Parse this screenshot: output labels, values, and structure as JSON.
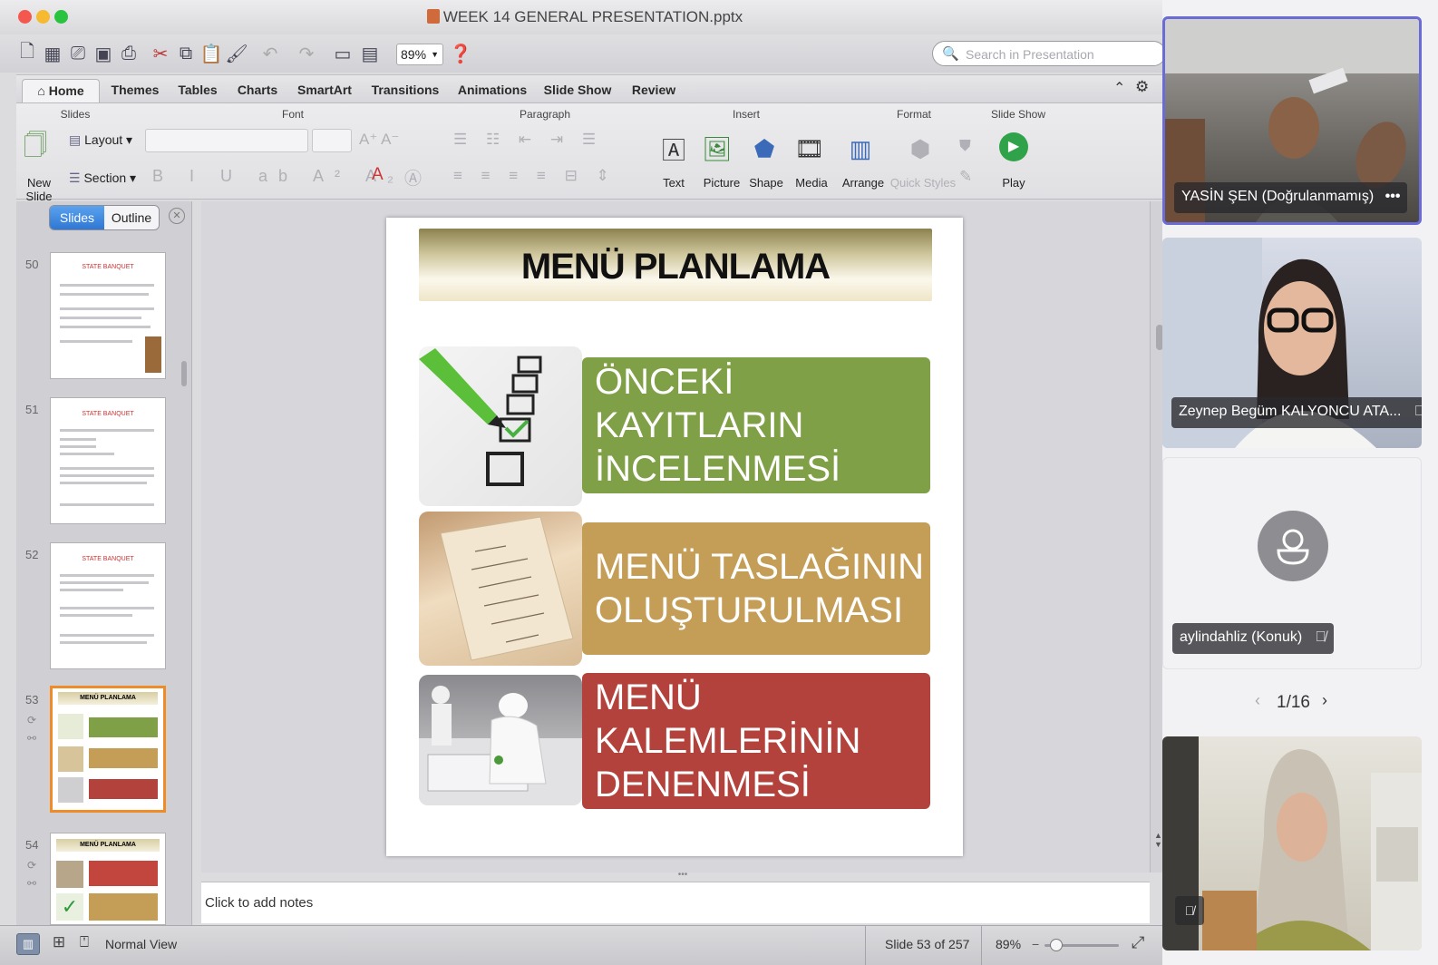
{
  "window": {
    "title": "WEEK 14 GENERAL PRESENTATION.pptx",
    "traffic_lights": [
      "#f4574d",
      "#f6b92f",
      "#29c33f"
    ]
  },
  "toolbar": {
    "zoom_value": "89%",
    "search_placeholder": "Search in Presentation"
  },
  "ribbon_tabs": [
    "Home",
    "Themes",
    "Tables",
    "Charts",
    "SmartArt",
    "Transitions",
    "Animations",
    "Slide Show",
    "Review"
  ],
  "ribbon": {
    "groups": {
      "slides": "Slides",
      "font": "Font",
      "paragraph": "Paragraph",
      "insert": "Insert",
      "format": "Format",
      "slideshow": "Slide Show"
    },
    "new_slide": "New Slide",
    "layout": "Layout",
    "section": "Section",
    "insert_items": [
      "Text",
      "Picture",
      "Shape",
      "Media"
    ],
    "arrange": "Arrange",
    "quick_styles": "Quick Styles",
    "play": "Play"
  },
  "left_pane": {
    "tabs": [
      "Slides",
      "Outline"
    ],
    "thumbnails": [
      {
        "number": "50",
        "title": "STATE BANQUET"
      },
      {
        "number": "51",
        "title": "STATE BANQUET"
      },
      {
        "number": "52",
        "title": "STATE BANQUET"
      },
      {
        "number": "53",
        "title": "MENÜ PLANLAMA"
      },
      {
        "number": "54",
        "title": "MENÜ PLANLAMA"
      }
    ]
  },
  "slide": {
    "title": "MENÜ PLANLAMA",
    "items": [
      {
        "line1": "ÖNCEKİ KAYITLARIN",
        "line2": "İNCELENMESİ",
        "color": "#7fa046"
      },
      {
        "line1": "MENÜ TASLAĞININ",
        "line2": "OLUŞTURULMASI",
        "color": "#c49d56"
      },
      {
        "line1": "MENÜ KALEMLERİNİN",
        "line2": "DENENMESİ",
        "color": "#b4423c"
      }
    ]
  },
  "notes_placeholder": "Click to add notes",
  "status": {
    "view": "Normal View",
    "slide_counter": "Slide 53 of 257",
    "zoom": "89%"
  },
  "participants": [
    {
      "name": "YASİN ŞEN (Doğrulanmamış)",
      "more": "•••"
    },
    {
      "name": "Zeynep Begüm KALYONCU ATA...",
      "muted": true
    },
    {
      "name": "aylindahliz (Konuk)",
      "muted": true
    }
  ],
  "pagination": "1/16"
}
